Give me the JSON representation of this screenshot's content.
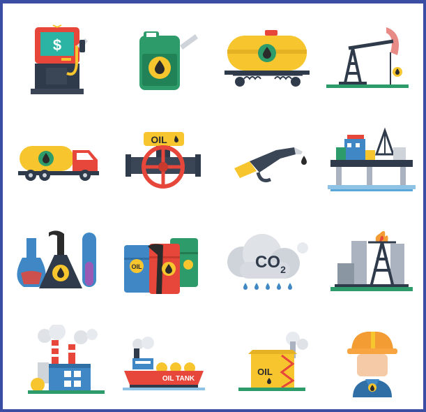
{
  "colors": {
    "frame": "#3a4fa3",
    "background": "#ffffff",
    "yellow": "#f7c62f",
    "green": "#2e9b6a",
    "red": "#e6473a",
    "blue": "#3f88c5",
    "dark": "#2f3a4a",
    "oil": "#2b2b2b"
  },
  "icons": [
    {
      "name": "fuel-pump-icon"
    },
    {
      "name": "jerrycan-icon"
    },
    {
      "name": "tank-rail-car-icon"
    },
    {
      "name": "pumpjack-icon"
    },
    {
      "name": "tank-truck-icon"
    },
    {
      "name": "pipeline-valve-icon",
      "label": "OIL"
    },
    {
      "name": "fuel-nozzle-icon"
    },
    {
      "name": "offshore-platform-icon"
    },
    {
      "name": "lab-flasks-icon"
    },
    {
      "name": "oil-barrels-icon",
      "label": "OIL"
    },
    {
      "name": "co2-cloud-icon",
      "label": "CO",
      "sub": "2"
    },
    {
      "name": "refinery-flare-icon"
    },
    {
      "name": "factory-icon"
    },
    {
      "name": "oil-tanker-ship-icon",
      "label": "OIL TANK"
    },
    {
      "name": "oil-storage-tank-icon",
      "label": "OIL"
    },
    {
      "name": "oil-worker-icon"
    }
  ]
}
